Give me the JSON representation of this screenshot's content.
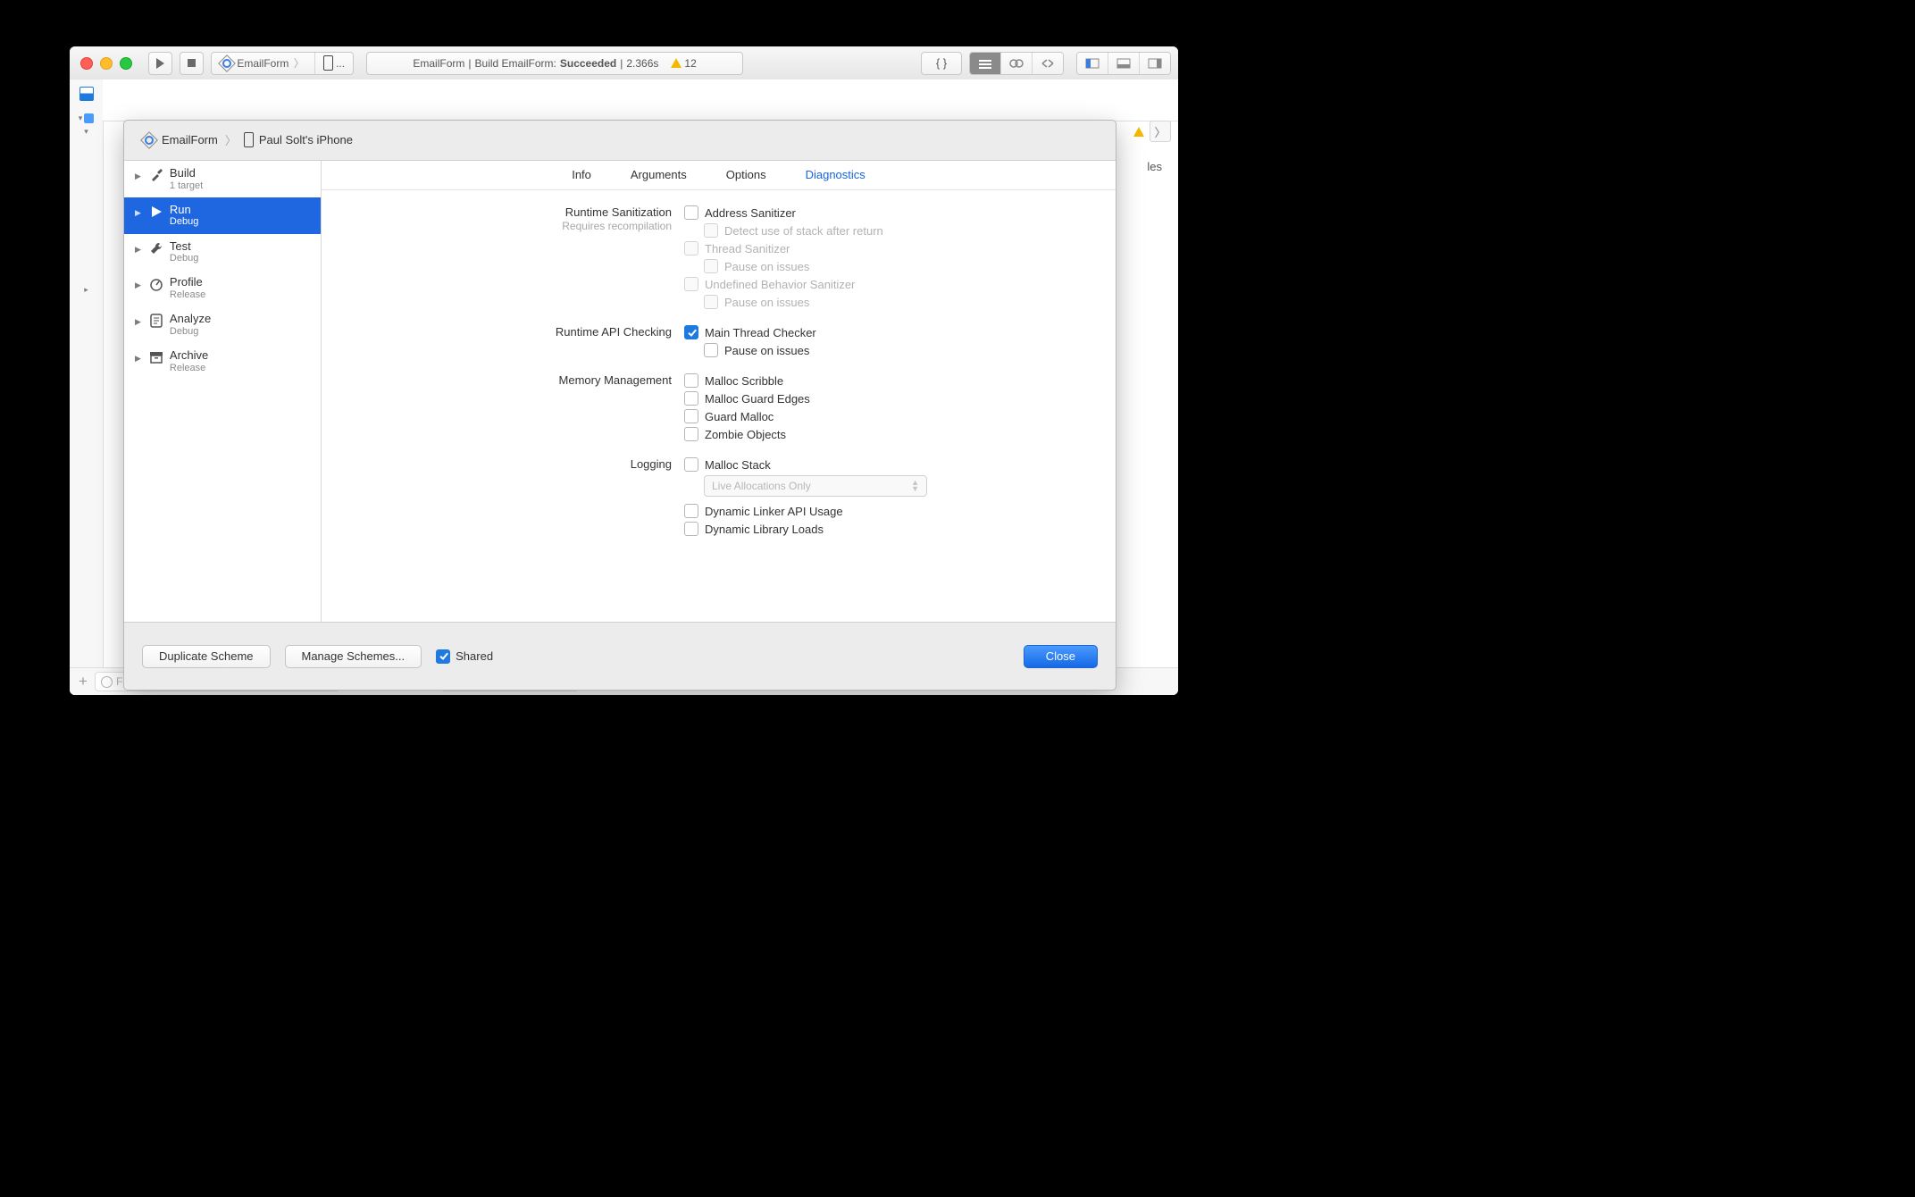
{
  "toolbar": {
    "scheme": "EmailForm",
    "destination": "...",
    "status": {
      "project": "EmailForm",
      "action": "Build EmailForm:",
      "result": "Succeeded",
      "time": "2.366s",
      "warnings": "12"
    }
  },
  "sheet": {
    "crumb": {
      "project": "EmailForm",
      "device": "Paul Solt's iPhone"
    },
    "side": [
      {
        "title": "Build",
        "sub": "1 target"
      },
      {
        "title": "Run",
        "sub": "Debug"
      },
      {
        "title": "Test",
        "sub": "Debug"
      },
      {
        "title": "Profile",
        "sub": "Release"
      },
      {
        "title": "Analyze",
        "sub": "Debug"
      },
      {
        "title": "Archive",
        "sub": "Release"
      }
    ],
    "tabs": {
      "info": "Info",
      "arguments": "Arguments",
      "options": "Options",
      "diagnostics": "Diagnostics"
    },
    "sections": {
      "runtime_sanitization": {
        "label": "Runtime Sanitization",
        "sub": "Requires recompilation",
        "address": "Address Sanitizer",
        "stack": "Detect use of stack after return",
        "thread": "Thread Sanitizer",
        "thread_pause": "Pause on issues",
        "ub": "Undefined Behavior Sanitizer",
        "ub_pause": "Pause on issues"
      },
      "api": {
        "label": "Runtime API Checking",
        "main_thread": "Main Thread Checker",
        "pause": "Pause on issues"
      },
      "memory": {
        "label": "Memory Management",
        "scribble": "Malloc Scribble",
        "guard_edges": "Malloc Guard Edges",
        "guard_malloc": "Guard Malloc",
        "zombie": "Zombie Objects"
      },
      "logging": {
        "label": "Logging",
        "malloc_stack": "Malloc Stack",
        "popup": "Live Allocations Only",
        "dlinker": "Dynamic Linker API Usage",
        "dlib": "Dynamic Library Loads"
      }
    },
    "buttons": {
      "duplicate": "Duplicate Scheme",
      "manage": "Manage Schemes...",
      "shared": "Shared",
      "close": "Close"
    }
  },
  "back": {
    "filter": "Filter",
    "les": "les"
  }
}
